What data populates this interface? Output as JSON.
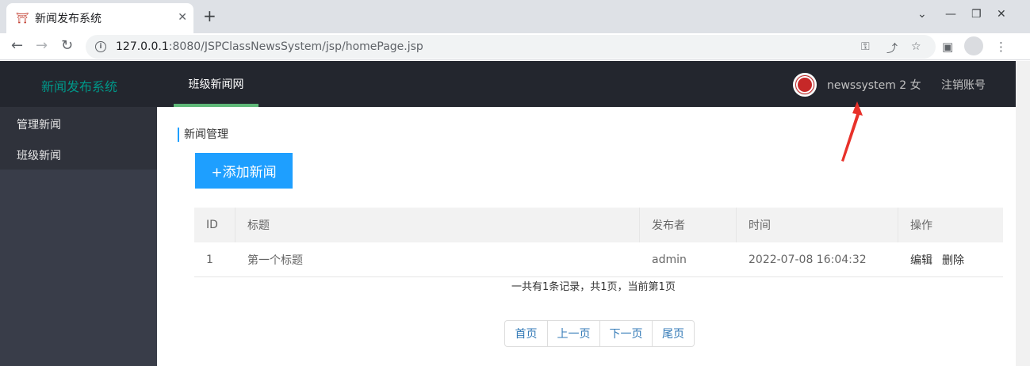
{
  "browser": {
    "tab_title": "新闻发布系统",
    "url_host": "127.0.0.1",
    "url_rest": ":8080/JSPClassNewsSystem/jsp/homePage.jsp"
  },
  "header": {
    "brand": "新闻发布系统",
    "nav_item": "班级新闻网",
    "user_name": "newssystem 2 女",
    "logout": "注销账号"
  },
  "sidebar": {
    "items": [
      {
        "label": "管理新闻"
      },
      {
        "label": "班级新闻"
      }
    ]
  },
  "main": {
    "section_title": "新闻管理",
    "add_button": "+添加新闻",
    "table": {
      "headers": [
        "ID",
        "标题",
        "发布者",
        "时间",
        "操作"
      ],
      "rows": [
        {
          "id": "1",
          "title": "第一个标题",
          "author": "admin",
          "time": "2022-07-08 16:04:32",
          "edit": "编辑",
          "delete": "删除"
        }
      ]
    },
    "summary": "一共有1条记录，共1页，当前第1页",
    "pager": [
      "首页",
      "上一页",
      "下一页",
      "尾页"
    ]
  },
  "colors": {
    "header_bg": "#23262e",
    "sidebar_bg": "#393d49",
    "accent_green": "#5fb878",
    "brand_teal": "#009688",
    "primary_blue": "#1e9fff",
    "annotation_red": "#e8312a"
  }
}
